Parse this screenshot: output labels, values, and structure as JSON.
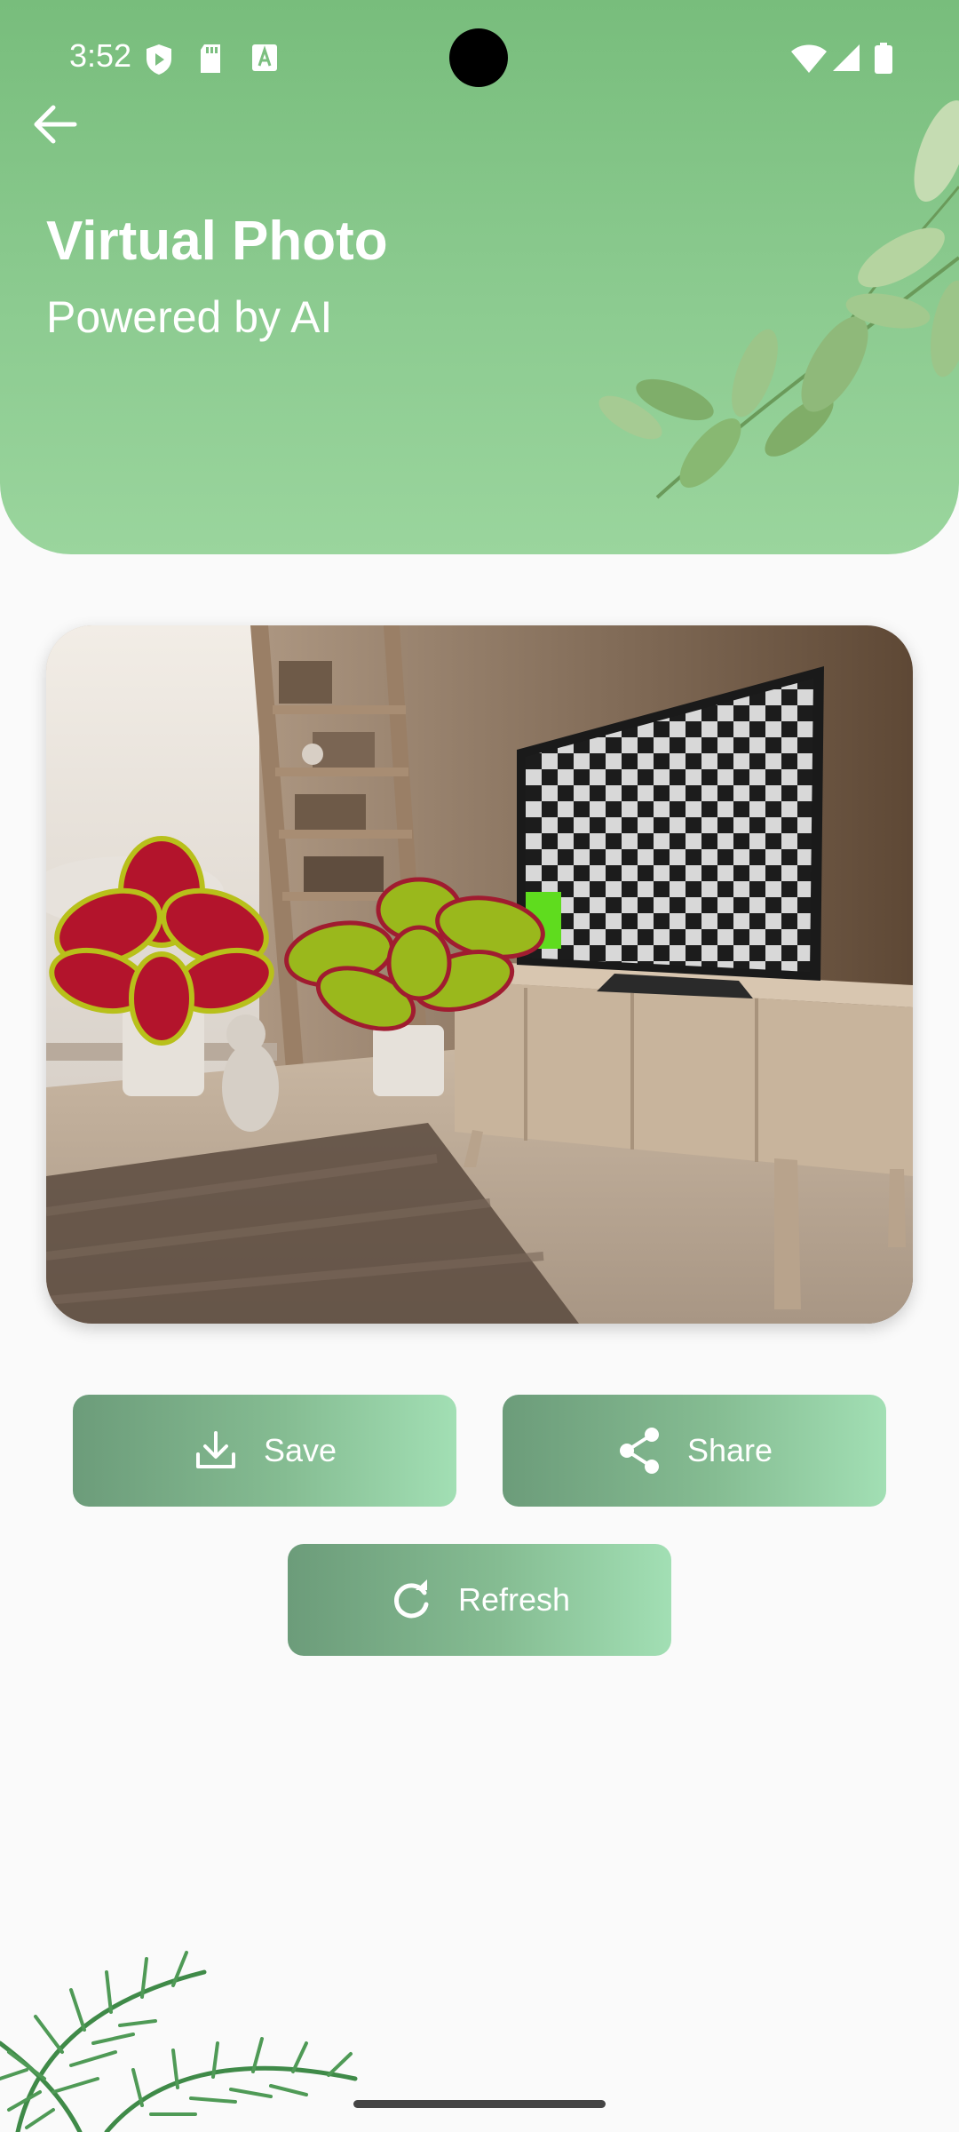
{
  "status_bar": {
    "time": "3:52",
    "left_icons": [
      "play-protect-icon",
      "sd-card-icon",
      "font-icon"
    ],
    "right_icons": [
      "wifi-icon",
      "signal-icon",
      "battery-icon"
    ]
  },
  "header": {
    "title": "Virtual Photo",
    "subtitle": "Powered by AI",
    "background_color": "#8ccb90"
  },
  "photo": {
    "scene": "living-room-with-plants-and-tv"
  },
  "actions": {
    "save_label": "Save",
    "share_label": "Share",
    "refresh_label": "Refresh",
    "button_gradient": [
      "#6c9c7a",
      "#a2dfb4"
    ]
  }
}
